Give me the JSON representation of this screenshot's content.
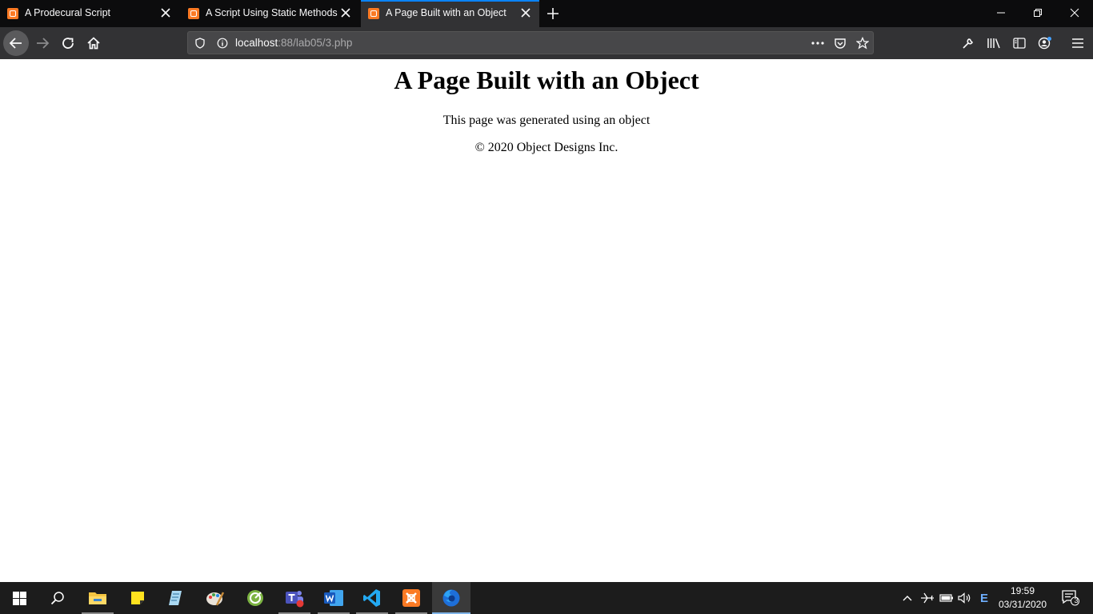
{
  "browser": {
    "tabs": [
      {
        "title": "A Prodecural Script",
        "active": false
      },
      {
        "title": "A Script Using Static Methods",
        "active": false
      },
      {
        "title": "A Page Built with an Object",
        "active": true
      }
    ],
    "url_host": "localhost",
    "url_rest": ":88/lab05/3.php",
    "accent": "#0a84ff"
  },
  "page": {
    "heading": "A Page Built with an Object",
    "paragraph": "This page was generated using an object",
    "footer": "© 2020 Object Designs Inc."
  },
  "taskbar": {
    "time": "19:59",
    "date": "03/31/2020",
    "notifications": "3",
    "ime_label": "E",
    "apps": [
      "file-explorer-icon",
      "sticky-notes-icon",
      "notepad-icon",
      "paint-icon",
      "greenshot-icon",
      "teams-icon",
      "word-icon",
      "vscode-icon",
      "xampp-icon",
      "firefox-icon"
    ]
  }
}
